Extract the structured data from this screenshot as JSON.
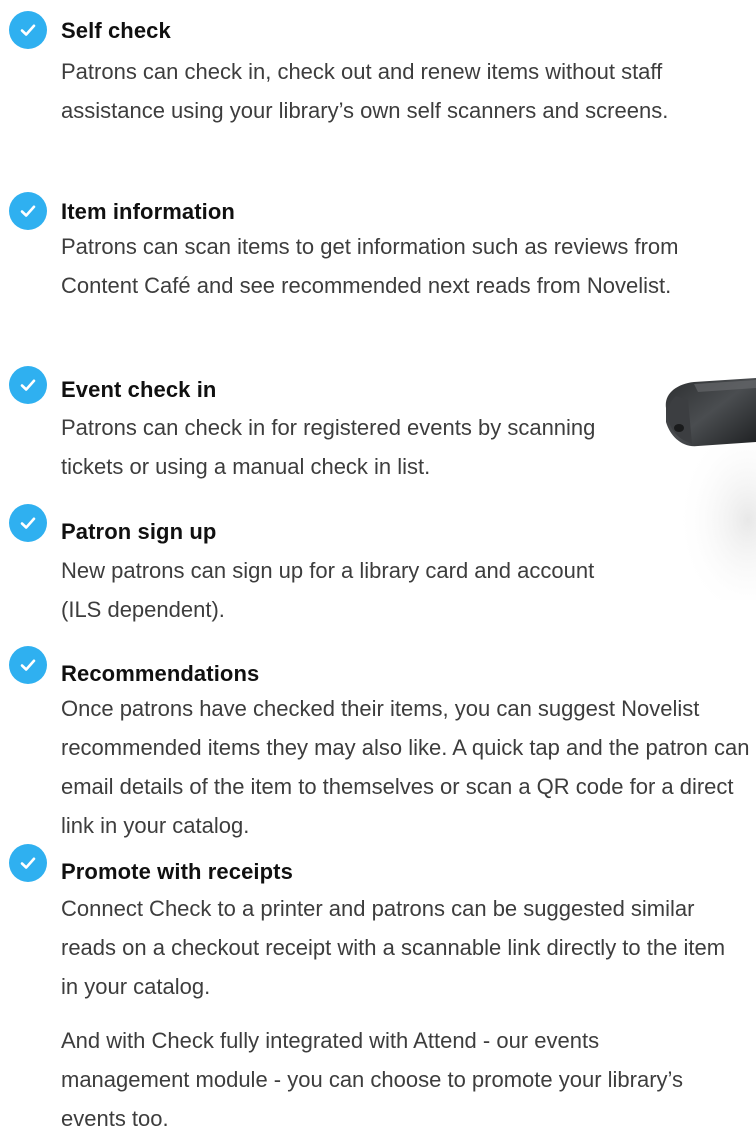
{
  "colors": {
    "accent": "#2fb0f0",
    "title": "#101010",
    "body": "#3d3d3d"
  },
  "features": [
    {
      "icon": "check-circle-icon",
      "title": "Self check",
      "description": "Patrons can check in, check out and renew items without staff assistance using your library’s own self scanners and screens."
    },
    {
      "icon": "check-circle-icon",
      "title": "Item information",
      "description": "Patrons can scan items to get information such as reviews from Content Café and see recommended next reads from Novelist."
    },
    {
      "icon": "check-circle-icon",
      "title": "Event check in",
      "description": "Patrons can check in for registered events by scanning tickets or using a manual check in list."
    },
    {
      "icon": "check-circle-icon",
      "title": "Patron sign up",
      "description": "New patrons can sign up for a library card and account (ILS dependent)."
    },
    {
      "icon": "check-circle-icon",
      "title": "Recommendations",
      "description": "Once patrons have checked their items, you can suggest Novelist recommended items they may also like. A quick tap and the patron can email details of the item to themselves or scan a QR code for a direct link in your catalog."
    },
    {
      "icon": "check-circle-icon",
      "title": "Promote with receipts",
      "description": "Connect Check to a printer and patrons can be suggested similar reads on a checkout receipt with a scannable link directly to the item in your catalog."
    }
  ],
  "closing": "And with Check fully integrated with Attend - our events management module - you can choose to promote your library’s events too."
}
